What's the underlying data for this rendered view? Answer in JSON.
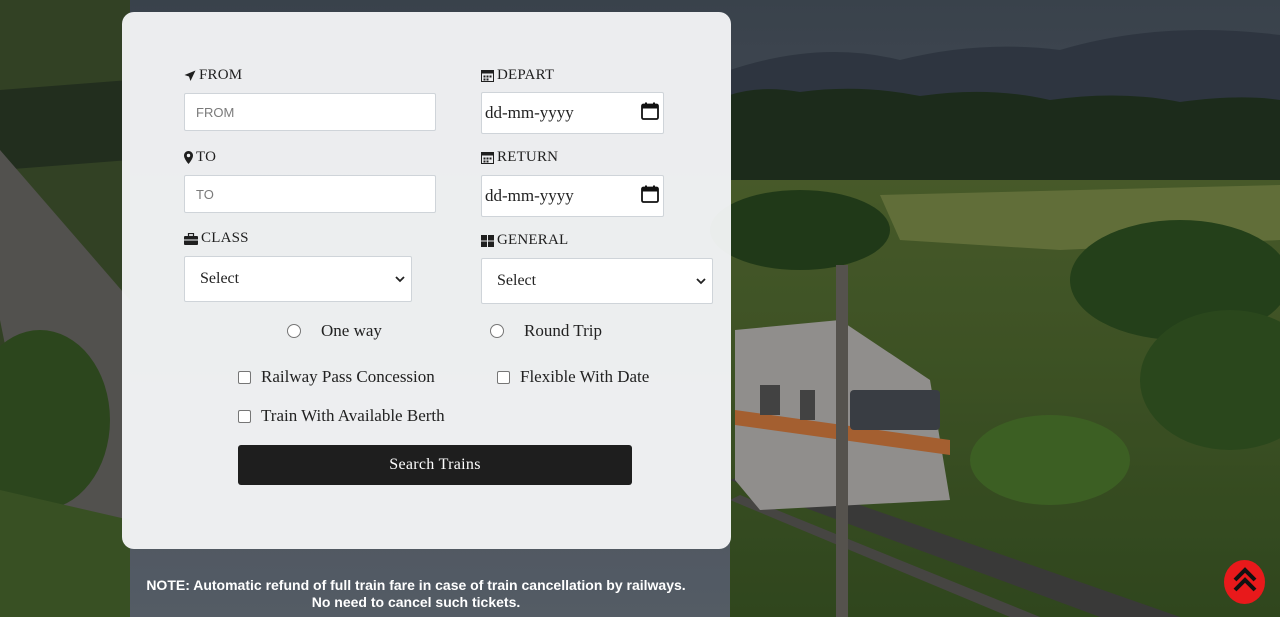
{
  "form": {
    "from_label": "FROM",
    "from_placeholder": "FROM",
    "to_label": "TO",
    "to_placeholder": "TO",
    "depart_label": "DEPART",
    "depart_value": "dd-mm-yyyy",
    "return_label": "RETURN",
    "return_value": "dd-mm-yyyy",
    "class_label": "CLASS",
    "class_value": "Select",
    "general_label": "GENERAL",
    "general_value": "Select",
    "one_way_label": "One way",
    "round_trip_label": "Round Trip",
    "railway_pass_label": "Railway Pass Concession",
    "flexible_date_label": "Flexible With Date",
    "available_berth_label": "Train With Available Berth",
    "search_label": "Search Trains"
  },
  "note": {
    "line1": "NOTE: Automatic refund of full train fare in case of train cancellation by railways.",
    "line2": "No need to cancel such tickets."
  },
  "icons": {
    "from": "location-arrow-icon",
    "to": "map-marker-icon",
    "depart": "calendar-icon",
    "return": "calendar-icon",
    "class": "briefcase-icon",
    "general": "grid-icon",
    "scroll_top": "double-chevron-up-icon"
  },
  "colors": {
    "button": "#1e1e1e",
    "scroll_top": "#e8191b",
    "card": "#f6f7f8"
  }
}
